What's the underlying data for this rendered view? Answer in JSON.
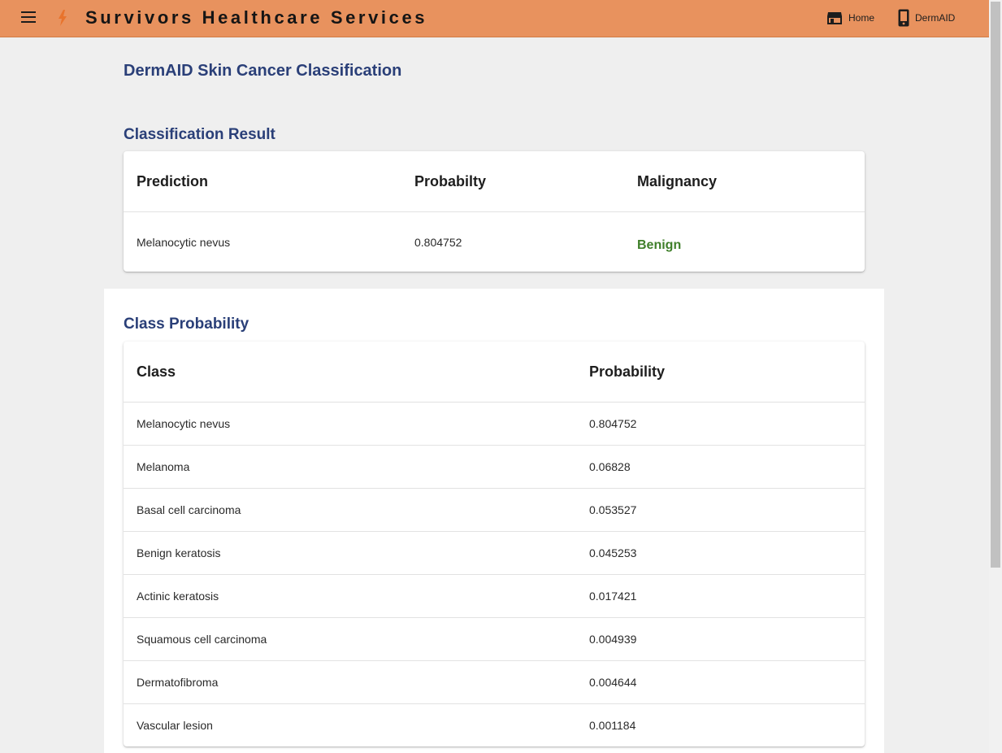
{
  "header": {
    "brand": "Survivors Healthcare Services",
    "nav": [
      {
        "label": "Home",
        "icon": "store-icon"
      },
      {
        "label": "DermAID",
        "icon": "phone-icon"
      }
    ],
    "colors": {
      "bar": "#e8925e",
      "bolt": "#e8732c"
    }
  },
  "page": {
    "title": "DermAID Skin Cancer Classification"
  },
  "result": {
    "title": "Classification Result",
    "headers": {
      "prediction": "Prediction",
      "probability": "Probabilty",
      "malignancy": "Malignancy"
    },
    "row": {
      "prediction": "Melanocytic nevus",
      "probability": "0.804752",
      "malignancy": "Benign"
    },
    "malignancy_color": "#3f7f2a"
  },
  "probabilities": {
    "title": "Class Probability",
    "headers": {
      "class": "Class",
      "probability": "Probability"
    },
    "rows": [
      {
        "class": "Melanocytic nevus",
        "probability": "0.804752"
      },
      {
        "class": "Melanoma",
        "probability": "0.06828"
      },
      {
        "class": "Basal cell carcinoma",
        "probability": "0.053527"
      },
      {
        "class": "Benign keratosis",
        "probability": "0.045253"
      },
      {
        "class": "Actinic keratosis",
        "probability": "0.017421"
      },
      {
        "class": "Squamous cell carcinoma",
        "probability": "0.004939"
      },
      {
        "class": "Dermatofibroma",
        "probability": "0.004644"
      },
      {
        "class": "Vascular lesion",
        "probability": "0.001184"
      }
    ]
  }
}
